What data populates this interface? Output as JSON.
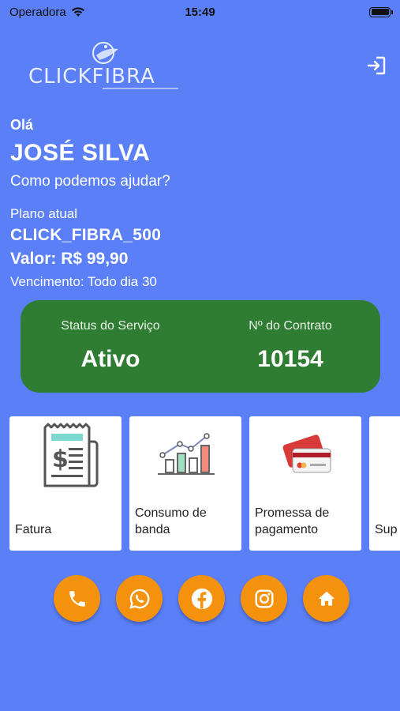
{
  "status_bar": {
    "carrier": "Operadora",
    "time": "15:49"
  },
  "logo": {
    "text": "CLICKFIBRA"
  },
  "greeting": {
    "hello": "Olá",
    "name": "JOSÉ SILVA",
    "help": "Como podemos ajudar?"
  },
  "plan": {
    "label": "Plano atual",
    "name": "CLICK_FIBRA_500",
    "value": "Valor: R$ 99,90",
    "due": "Vencimento: Todo dia 30"
  },
  "service": {
    "status_label": "Status do Serviço",
    "status_value": "Ativo",
    "contract_label": "Nº do Contrato",
    "contract_value": "10154"
  },
  "cards": [
    {
      "label": "Fatura",
      "icon": "invoice-icon"
    },
    {
      "label": "Consumo de banda",
      "icon": "bar-chart-icon"
    },
    {
      "label": "Promessa de pagamento",
      "icon": "credit-card-icon"
    },
    {
      "label": "Sup",
      "icon": "support-icon"
    }
  ],
  "socials": [
    "phone-icon",
    "whatsapp-icon",
    "facebook-icon",
    "instagram-icon",
    "home-icon"
  ],
  "colors": {
    "background": "#5b7ff7",
    "status_card": "#2e7d32",
    "social_button": "#f5920d"
  }
}
